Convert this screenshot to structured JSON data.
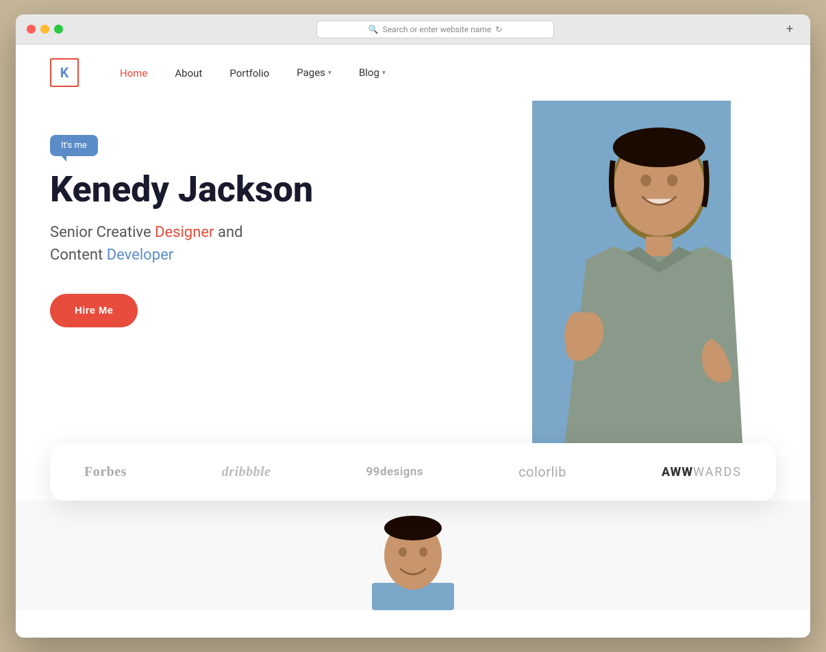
{
  "browser": {
    "address_placeholder": "Search or enter website name",
    "new_tab_symbol": "+",
    "traffic_lights": [
      "red",
      "yellow",
      "green"
    ]
  },
  "navbar": {
    "logo_letter": "K",
    "links": [
      {
        "label": "Home",
        "active": true,
        "has_arrow": false
      },
      {
        "label": "About",
        "active": false,
        "has_arrow": false
      },
      {
        "label": "Portfolio",
        "active": false,
        "has_arrow": false
      },
      {
        "label": "Pages",
        "active": false,
        "has_arrow": true
      },
      {
        "label": "Blog",
        "active": false,
        "has_arrow": true
      }
    ]
  },
  "hero": {
    "bubble_text": "It's me",
    "name": "Kenedy Jackson",
    "subtitle_prefix": "Senior Creative ",
    "subtitle_designer": "Designer",
    "subtitle_middle": " and",
    "subtitle_content": "Content ",
    "subtitle_developer": "Developer",
    "cta_button": "Hire Me"
  },
  "brands": [
    {
      "label": "Forbes",
      "class": "forbes"
    },
    {
      "label": "dribbble",
      "class": "dribbble"
    },
    {
      "label": "99designs",
      "class": "designs"
    },
    {
      "label": "colorlib",
      "class": "colorlib"
    },
    {
      "label_bold": "AWW",
      "label_light": "WARDS",
      "class": "awwwards"
    }
  ],
  "colors": {
    "accent_red": "#e74c3c",
    "accent_blue": "#5b8cc8",
    "bg_hero_right": "#7ba7c9",
    "logo_border": "#e74c3c",
    "logo_text": "#5b8cc8"
  }
}
